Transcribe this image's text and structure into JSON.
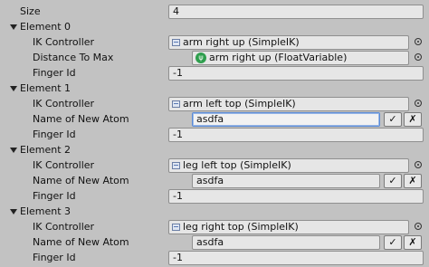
{
  "size": {
    "label": "Size",
    "value": "4"
  },
  "elements": [
    {
      "header": "Element 0",
      "ik_label": "IK Controller",
      "ik_value": "arm right up (SimpleIK)",
      "second_label": "Distance To Max",
      "second_value": "arm right up (FloatVariable)",
      "finger_label": "Finger Id",
      "finger_value": "-1"
    },
    {
      "header": "Element 1",
      "ik_label": "IK Controller",
      "ik_value": "arm left top (SimpleIK)",
      "second_label": "Name of New Atom",
      "second_value": "asdfa",
      "finger_label": "Finger Id",
      "finger_value": "-1"
    },
    {
      "header": "Element 2",
      "ik_label": "IK Controller",
      "ik_value": "leg left top (SimpleIK)",
      "second_label": "Name of New Atom",
      "second_value": "asdfa",
      "finger_label": "Finger Id",
      "finger_value": "-1"
    },
    {
      "header": "Element 3",
      "ik_label": "IK Controller",
      "ik_value": "leg right top (SimpleIK)",
      "second_label": "Name of New Atom",
      "second_value": "asdfa",
      "finger_label": "Finger Id",
      "finger_value": "-1"
    }
  ],
  "buttons": {
    "confirm": "✓",
    "cancel": "✗"
  },
  "colors": {
    "background": "#c2c2c2",
    "field": "#e6e6e6",
    "focus_border": "#5a8ad6",
    "variable_icon": "#2e9e4d"
  },
  "icons": {
    "object": "script-object-icon",
    "variable": "float-variable-icon",
    "picker": "object-picker-icon",
    "foldout": "foldout-arrow-icon"
  }
}
